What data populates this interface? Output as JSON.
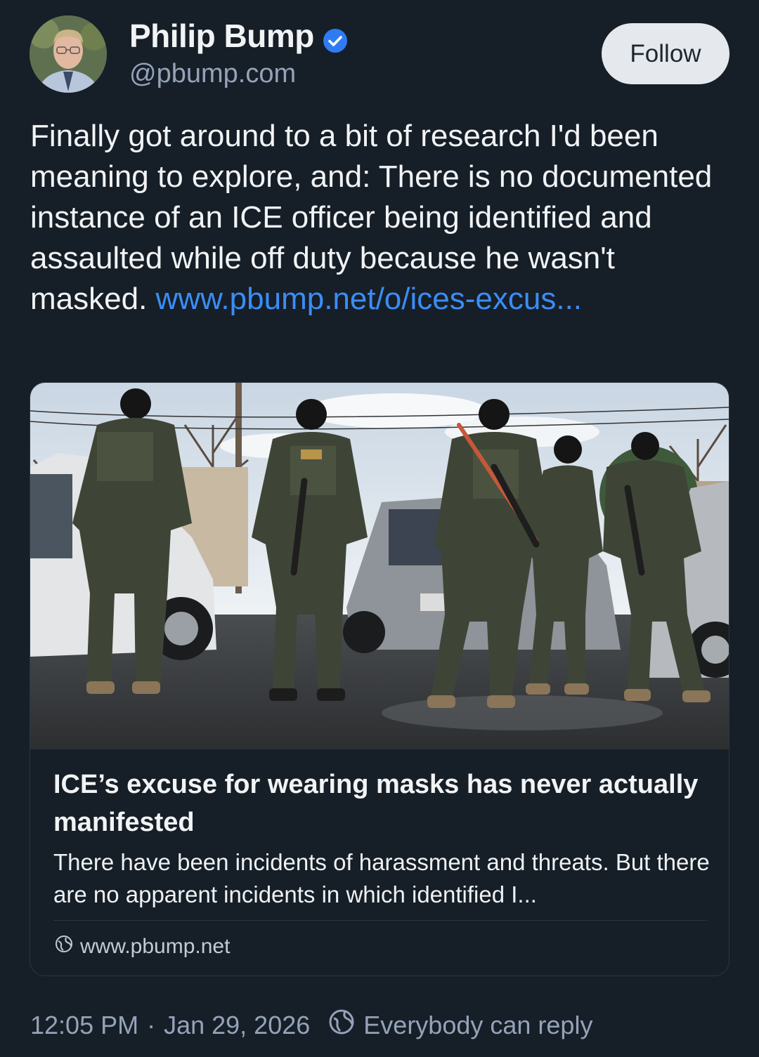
{
  "author": {
    "name": "Philip Bump",
    "handle": "@pbump.com",
    "verified": true
  },
  "follow_label": "Follow",
  "post": {
    "text": "Finally got around to a bit of research I'd been meaning to explore, and: There is no documented instance of an ICE officer being identified and assaulted while off duty because he wasn't masked.",
    "link_text": "www.pbump.net/o/ices-excus..."
  },
  "link_card": {
    "title": "ICE’s excuse for wearing masks has never actually manifested",
    "description": "There have been incidents of harassment and threats. But there are no apparent incidents in which identified I...",
    "domain": "www.pbump.net"
  },
  "meta": {
    "time": "12:05 PM",
    "separator": "·",
    "date": "Jan 29, 2026",
    "reply_setting": "Everybody can reply"
  },
  "colors": {
    "background": "#161e27",
    "link": "#3b8df5",
    "verified": "#2f7bf2",
    "muted_text": "#94a3b8"
  },
  "icons": {
    "verified": "verified-badge-icon",
    "globe": "globe-icon",
    "reply": "reply-permission-icon"
  }
}
